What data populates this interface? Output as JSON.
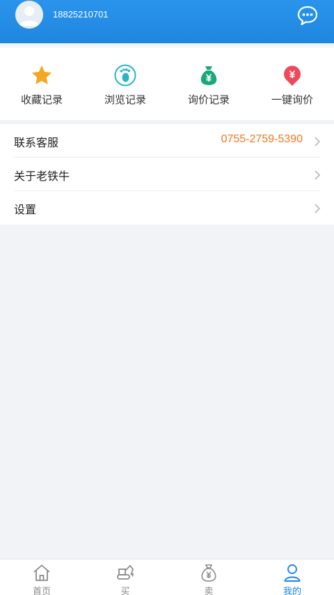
{
  "header": {
    "phone": "18825210701",
    "bg_color": "#2a94ec",
    "message_icon": "chat-bubble-icon"
  },
  "quick_actions": [
    {
      "label": "收藏记录",
      "icon": "star-icon",
      "color": "#f5a623"
    },
    {
      "label": "浏览记录",
      "icon": "footprint-icon",
      "color": "#2bb3c9"
    },
    {
      "label": "询价记录",
      "icon": "money-bag-icon",
      "color": "#1aa879"
    },
    {
      "label": "一键询价",
      "icon": "price-tag-icon",
      "color": "#ee4a5c"
    }
  ],
  "menu": [
    {
      "label": "联系客服",
      "value": "0755-2759-5390"
    },
    {
      "label": "关于老铁牛",
      "value": ""
    },
    {
      "label": "设置",
      "value": ""
    }
  ],
  "tabbar": {
    "active_color": "#1f86de",
    "items": [
      {
        "label": "首页",
        "icon": "home-icon"
      },
      {
        "label": "买",
        "icon": "excavator-icon"
      },
      {
        "label": "卖",
        "icon": "money-bag-icon"
      },
      {
        "label": "我的",
        "icon": "user-icon"
      }
    ],
    "active_index": 3
  }
}
